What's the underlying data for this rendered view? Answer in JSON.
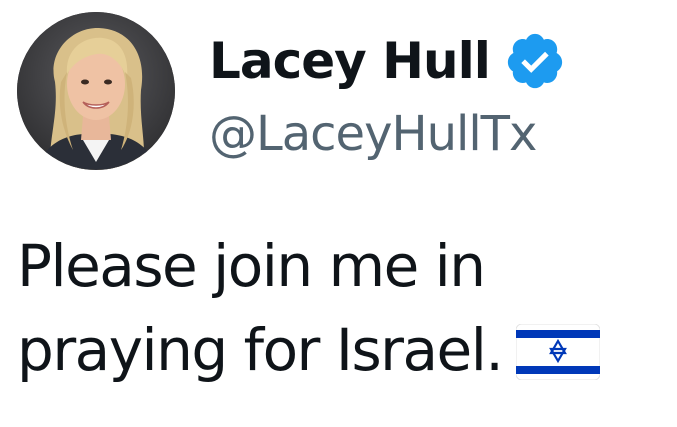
{
  "author": {
    "display_name": "Lacey Hull",
    "handle": "@LaceyHullTx",
    "verified": true,
    "verified_icon": "verified-badge-icon",
    "avatar": "profile-photo"
  },
  "tweet": {
    "line1": "Please join me in",
    "line2": "praying for Israel.",
    "emoji": "israel-flag-icon"
  },
  "colors": {
    "text": "#0f1419",
    "handle": "#536471",
    "verified_blue": "#1d9bf0",
    "flag_blue": "#0038b8"
  }
}
